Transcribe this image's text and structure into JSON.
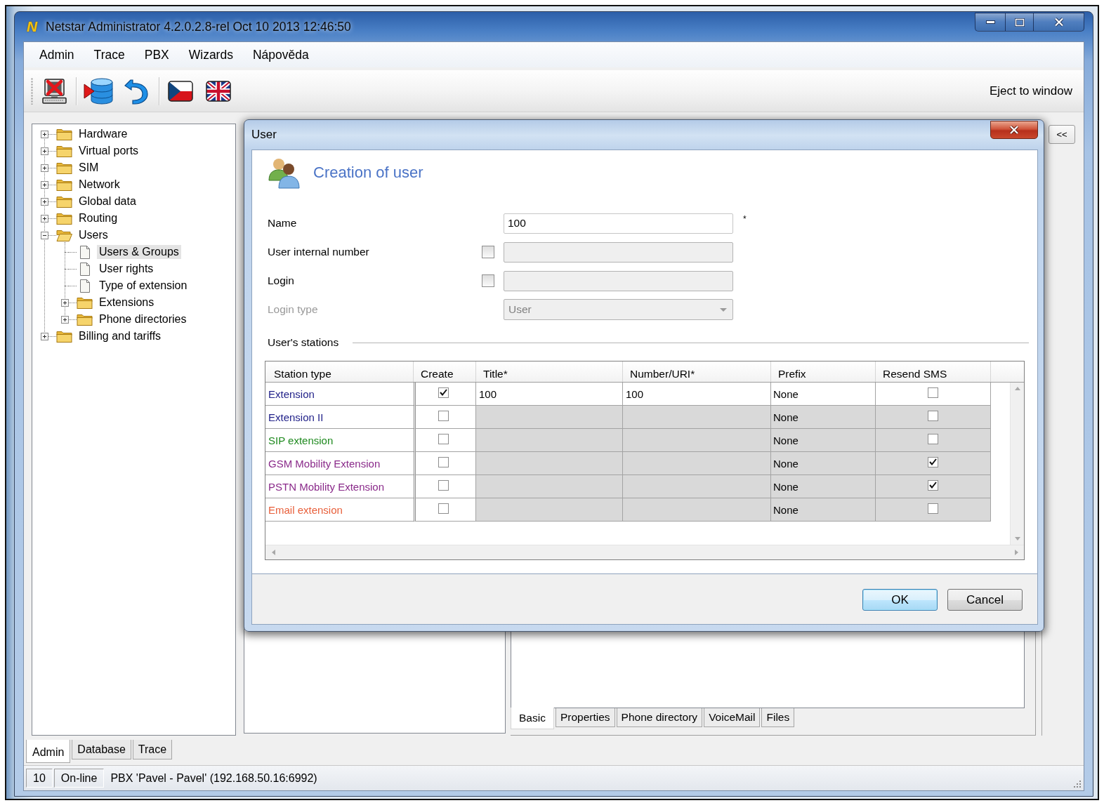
{
  "window": {
    "logo": "N",
    "title": "Netstar Administrator 4.2.0.2.8-rel Oct 10 2013 12:46:50"
  },
  "menu": [
    {
      "label": "Admin"
    },
    {
      "label": "Trace"
    },
    {
      "label": "PBX"
    },
    {
      "label": "Wizards"
    },
    {
      "label": "Nápověda"
    }
  ],
  "toolbar": {
    "eject_link": "Eject to window"
  },
  "tree": [
    {
      "label": "Hardware",
      "kind": "folder",
      "expanded": false,
      "selected": false
    },
    {
      "label": "Virtual ports",
      "kind": "folder",
      "expanded": false,
      "selected": false
    },
    {
      "label": "SIM",
      "kind": "folder",
      "expanded": false,
      "selected": false
    },
    {
      "label": "Network",
      "kind": "folder",
      "expanded": false,
      "selected": false
    },
    {
      "label": "Global data",
      "kind": "folder",
      "expanded": false,
      "selected": false
    },
    {
      "label": "Routing",
      "kind": "folder",
      "expanded": false,
      "selected": false
    },
    {
      "label": "Users",
      "kind": "folder",
      "expanded": true,
      "selected": false,
      "children": [
        {
          "label": "Users & Groups",
          "kind": "page",
          "selected": true
        },
        {
          "label": "User rights",
          "kind": "page",
          "selected": false
        },
        {
          "label": "Type of extension",
          "kind": "page",
          "selected": false
        },
        {
          "label": "Extensions",
          "kind": "folder",
          "expanded": false,
          "selected": false
        },
        {
          "label": "Phone directories",
          "kind": "folder",
          "expanded": false,
          "selected": false
        }
      ]
    },
    {
      "label": "Billing and tariffs",
      "kind": "folder",
      "expanded": false,
      "selected": false
    }
  ],
  "detail_tabs": [
    {
      "label": "Basic",
      "selected": true
    },
    {
      "label": "Properties",
      "selected": false
    },
    {
      "label": "Phone directory",
      "selected": false
    },
    {
      "label": "VoiceMail",
      "selected": false
    },
    {
      "label": "Files",
      "selected": false
    }
  ],
  "side_toggle": {
    "label": "<<"
  },
  "bottom_tabs": [
    {
      "label": "Admin",
      "selected": true
    },
    {
      "label": "Database",
      "selected": false
    },
    {
      "label": "Trace",
      "selected": false
    }
  ],
  "status_bar": {
    "count": "10",
    "state": "On-line",
    "connection": "PBX 'Pavel - Pavel' (192.168.50.16:6992)"
  },
  "dialog": {
    "title": "User",
    "heading": "Creation of user",
    "fields": [
      {
        "kind": "text",
        "label": "Name",
        "value": "100",
        "marker": "*",
        "disabled": false
      },
      {
        "kind": "optional_text",
        "label": "User internal number",
        "checked": false,
        "disabled": false
      },
      {
        "kind": "optional_text",
        "label": "Login",
        "checked": false,
        "disabled": false
      },
      {
        "kind": "select",
        "label": "Login type",
        "value": "User",
        "disabled": true
      }
    ],
    "stations_label": "User's stations",
    "stations": {
      "columns": [
        "Station type",
        "Create",
        "Title*",
        "Number/URI*",
        "Prefix",
        "Resend SMS"
      ],
      "rows": [
        {
          "station_type": "Extension",
          "color": "#23238a",
          "create": true,
          "title": "100",
          "number": "100",
          "prefix": "None",
          "resend_sms": false
        },
        {
          "station_type": "Extension II",
          "color": "#23238a",
          "create": false,
          "prefix": "None",
          "resend_sms": false
        },
        {
          "station_type": "SIP extension",
          "color": "#1f8a1f",
          "create": false,
          "prefix": "None",
          "resend_sms": false
        },
        {
          "station_type": "GSM Mobility Extension",
          "color": "#8a2a8a",
          "create": false,
          "prefix": "None",
          "resend_sms": true
        },
        {
          "station_type": "PSTN Mobility Extension",
          "color": "#8a2a8a",
          "create": false,
          "prefix": "None",
          "resend_sms": true
        },
        {
          "station_type": "Email extension",
          "color": "#e8603c",
          "create": false,
          "prefix": "None",
          "resend_sms": false
        }
      ]
    },
    "buttons": [
      {
        "label": "OK",
        "default": true
      },
      {
        "label": "Cancel",
        "default": false
      }
    ]
  }
}
